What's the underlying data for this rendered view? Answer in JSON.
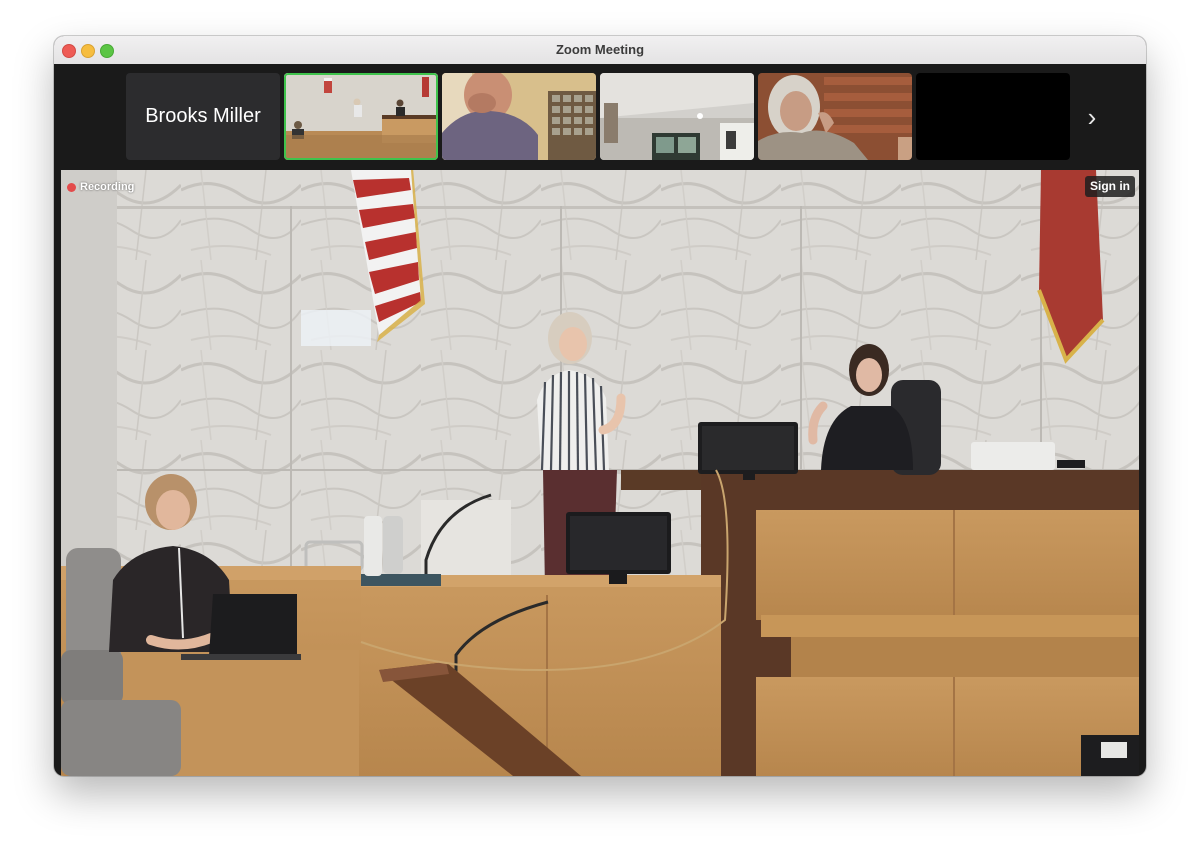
{
  "window": {
    "title": "Zoom Meeting"
  },
  "gallery": {
    "participants": [
      {
        "name": "Brooks Miller",
        "video": false,
        "active": false
      },
      {
        "name": "",
        "video": true,
        "active": true
      },
      {
        "name": "",
        "video": true,
        "active": false
      },
      {
        "name": "",
        "video": true,
        "active": false
      },
      {
        "name": "",
        "video": true,
        "active": false
      },
      {
        "name": "",
        "video": false,
        "active": false
      }
    ],
    "next_icon": "chevron-right-icon"
  },
  "main_video": {
    "recording_label": "Recording",
    "signin_label": "Sign in"
  },
  "colors": {
    "active_speaker": "#3fc34c",
    "recording": "#e34b4b"
  }
}
